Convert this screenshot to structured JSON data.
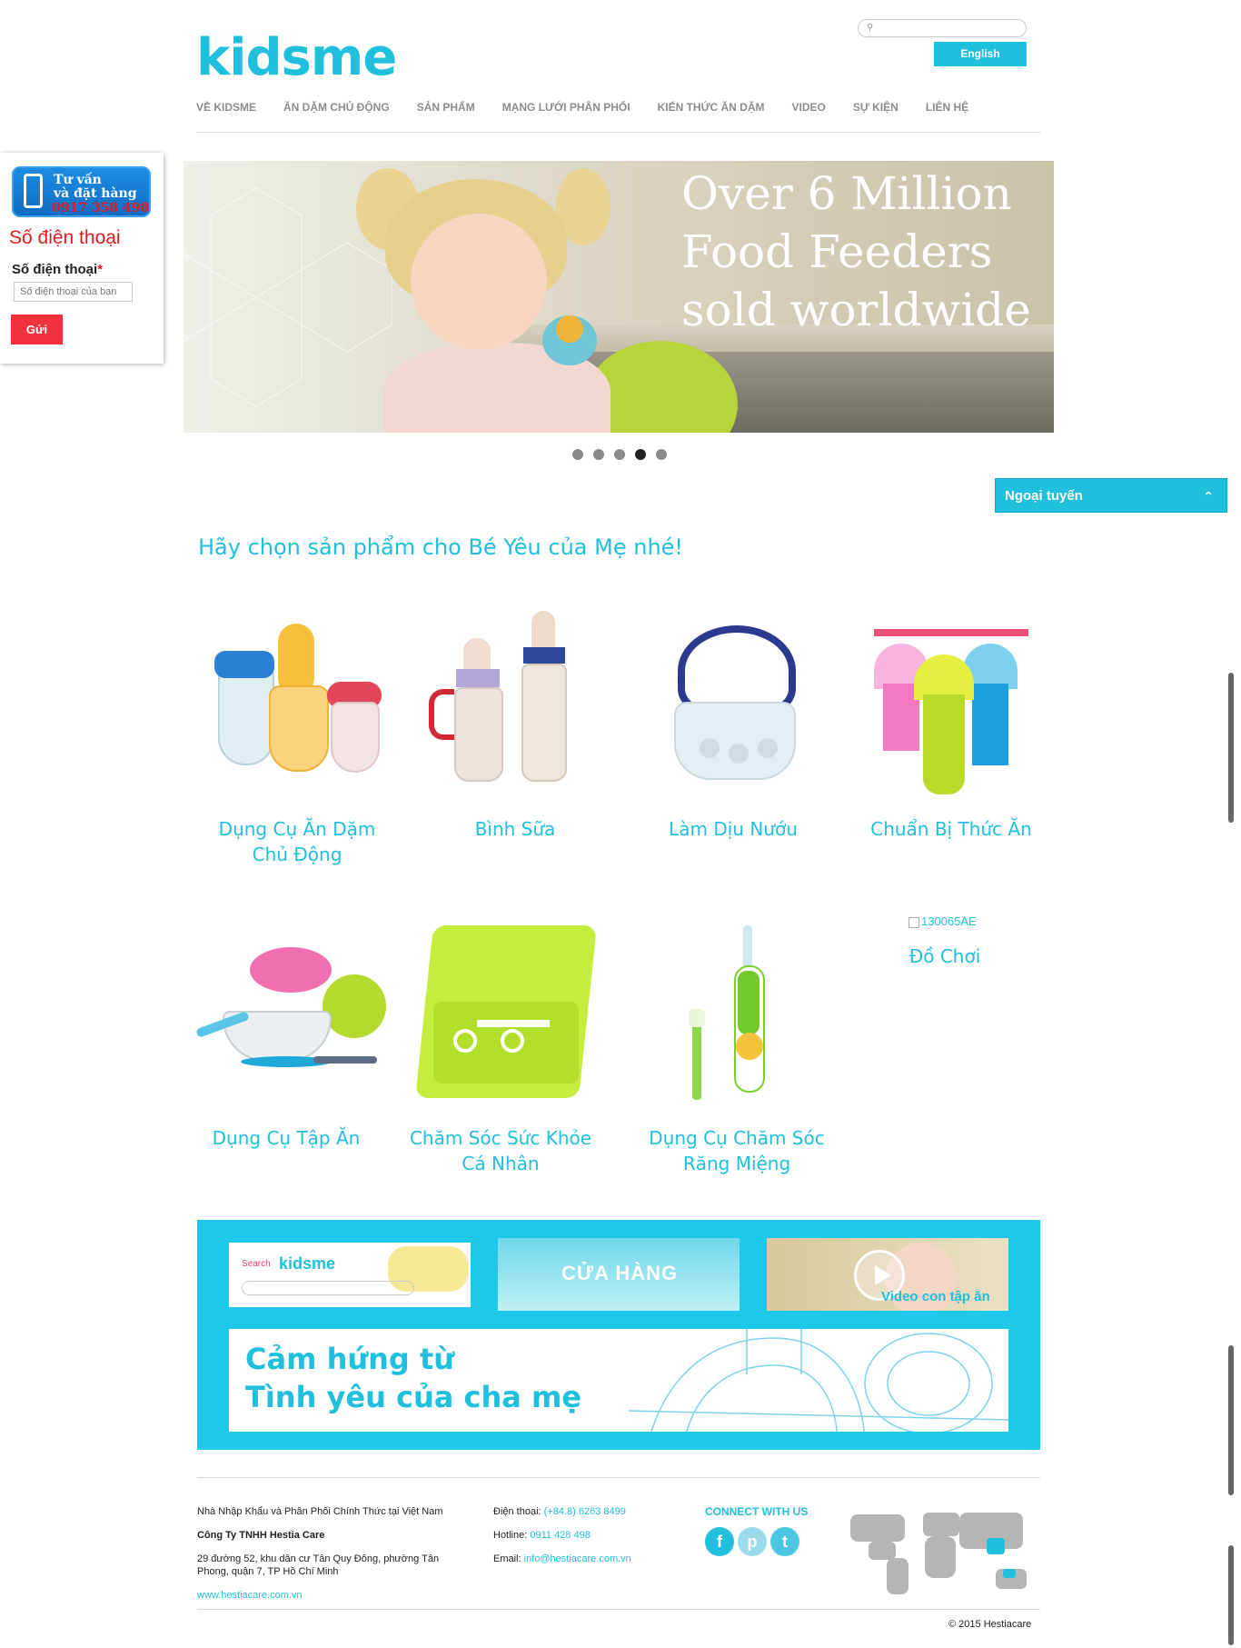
{
  "header": {
    "logo": "kidsme",
    "search_placeholder": "",
    "language_button": "English",
    "nav": [
      "VỀ KIDSME",
      "ĂN DẶM CHỦ ĐỘNG",
      "SẢN PHẨM",
      "MẠNG LƯỚI PHÂN PHỐI",
      "KIẾN THỨC ĂN DẶM",
      "VIDEO",
      "SỰ KIỆN",
      "LIÊN HỆ"
    ]
  },
  "contact_form": {
    "banner_line1": "Tư vấn",
    "banner_line2": "và đặt hàng",
    "banner_phone": "0917 358 498",
    "title": "Số điện thoại",
    "field_label": "Số điện thoại",
    "required_mark": "*",
    "input_placeholder": "Số điện thoại của bạn",
    "submit_label": "Gửi"
  },
  "hero": {
    "slogan_line1": "Over 6 Million",
    "slogan_line2": "Food Feeders",
    "slogan_line3": "sold worldwide",
    "slide_count": 5,
    "active_slide": 4
  },
  "chat": {
    "status_label": "Ngoại tuyến",
    "toggle_icon": "chevron-up-icon"
  },
  "products_section": {
    "title": "Hãy chọn sản phẩm cho Bé Yêu của Mẹ nhé!",
    "items": [
      {
        "name_line1": "Dụng Cụ Ăn Dặm",
        "name_line2": "Chủ Động"
      },
      {
        "name_line1": "Bình Sữa",
        "name_line2": ""
      },
      {
        "name_line1": "Làm Dịu Nướu",
        "name_line2": ""
      },
      {
        "name_line1": "Chuẩn Bị Thức Ăn",
        "name_line2": ""
      },
      {
        "name_line1": "Dụng Cụ Tập Ăn",
        "name_line2": ""
      },
      {
        "name_line1": "Chăm Sóc Sức Khỏe",
        "name_line2": "Cá Nhân"
      },
      {
        "name_line1": "Dụng Cụ Chăm Sóc",
        "name_line2": "Răng Miệng"
      },
      {
        "name_line1": "Đồ Chơi",
        "name_line2": "",
        "image_alt": "130065AE"
      }
    ]
  },
  "promo": {
    "search_label": "Search",
    "search_brand": "kidsme",
    "store_label": "CỬA HÀNG",
    "video_label": "Video con tập ăn",
    "inspire_line1": "Cảm hứng từ",
    "inspire_line2": "Tình yêu của cha mẹ"
  },
  "footer": {
    "importer": "Nhà Nhập Khẩu và Phân Phối Chính Thức tại Việt Nam",
    "company": "Công Ty TNHH Hestia Care",
    "address": "29 đường 52, khu dân cư Tân Quy Đông, phường Tân Phong, quận 7, TP Hồ Chí Minh",
    "website": "www.hestiacare.com.vn",
    "phone_label": "Điện thoại:",
    "phone_value": "(+84.8) 6263 8499",
    "hotline_label": "Hotline:",
    "hotline_value": "0911 428 498",
    "email_label": "Email:",
    "email_value": "info@hestiacare.com.vn",
    "connect_title": "CONNECT WITH US",
    "social": [
      "f",
      "p",
      "t"
    ],
    "copyright": "© 2015 Hestiacare"
  },
  "colors": {
    "brand_cyan": "#1fbfdd",
    "brand_green": "#9bd240",
    "accent_red": "#f0323c"
  }
}
